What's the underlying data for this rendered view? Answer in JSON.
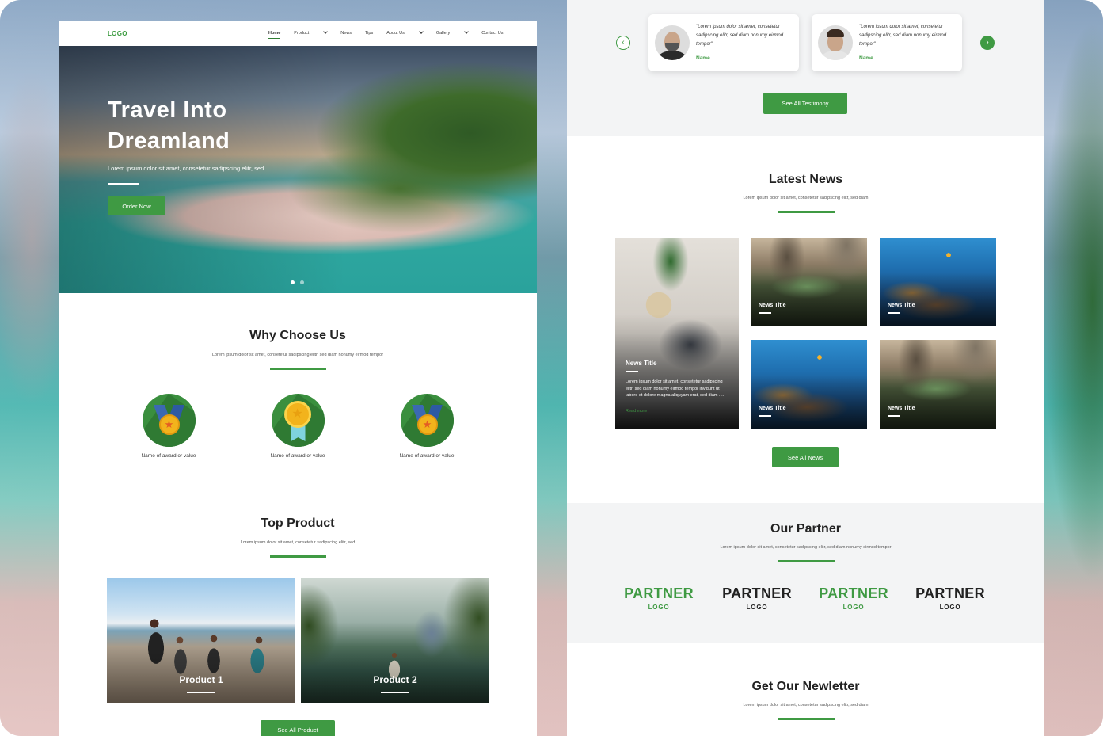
{
  "left": {
    "nav": {
      "logo": "LOGO",
      "items": [
        "Home",
        "Product",
        "News",
        "Tips",
        "About Us",
        "Gallery",
        "Contact Us"
      ]
    },
    "hero": {
      "title_line1": "Travel Into",
      "title_line2": "Dreamland",
      "subtitle": "Lorem ipsum dolor sit amet, consetetur sadipscing elitr, sed",
      "cta": "Order Now"
    },
    "why": {
      "title": "Why Choose Us",
      "subtitle": "Lorem ipsum dolor sit amet, consetetur sadipscing elitr, sed diam nonumy eirmod tempor",
      "awards": [
        "Name of award or value",
        "Name of award or value",
        "Name of award or value"
      ]
    },
    "products": {
      "title": "Top Product",
      "subtitle": "Lorem ipsum dolor sit amet, consetetur sadipscing elitr, sed",
      "items": [
        "Product 1",
        "Product 2"
      ],
      "see_all": "See All Product"
    }
  },
  "right": {
    "testimonials": {
      "items": [
        {
          "quote": "\"Lorem ipsum dolor sit amet, consetetur sadipscing elitr, sed diam nonumy eirmod tempor\"",
          "name": "Name"
        },
        {
          "quote": "\"Lorem ipsum dolor sit amet, consetetur sadipscing elitr, sed diam nonumy eirmod tempor\"",
          "name": "Name"
        }
      ],
      "see_all": "See All Testimony"
    },
    "news": {
      "title": "Latest News",
      "subtitle": "Lorem ipsum dolor sit amet, consetetur sadipscing elitr, sed diam",
      "featured": {
        "title": "News Title",
        "desc": "Lorem ipsum dolor sit amet, consetetur sadipscing elitr, sed diam nonumy eirmod tempor invidunt ut labore et dolore magna aliquyam erat, sed diam ....",
        "read_more": "Read more"
      },
      "items": [
        "News Title",
        "News Title",
        "News Title",
        "News Title"
      ],
      "see_all": "See All News"
    },
    "partners": {
      "title": "Our Partner",
      "subtitle": "Lorem ipsum dolor sit amet, consetetur sadipscing elitr, sed diam nonumy eirmod tempor",
      "logos": [
        {
          "name": "PARTNER",
          "sub": "LOGO"
        },
        {
          "name": "PARTNER",
          "sub": "LOGO"
        },
        {
          "name": "PARTNER",
          "sub": "LOGO"
        },
        {
          "name": "PARTNER",
          "sub": "LOGO"
        }
      ]
    },
    "newsletter": {
      "title": "Get Our Newletter",
      "subtitle": "Lorem ipsum dolor sit amet, consetetur sadipscing elitr, sed diam"
    }
  },
  "colors": {
    "accent": "#3f9a43",
    "section_bg": "#f3f4f5"
  }
}
